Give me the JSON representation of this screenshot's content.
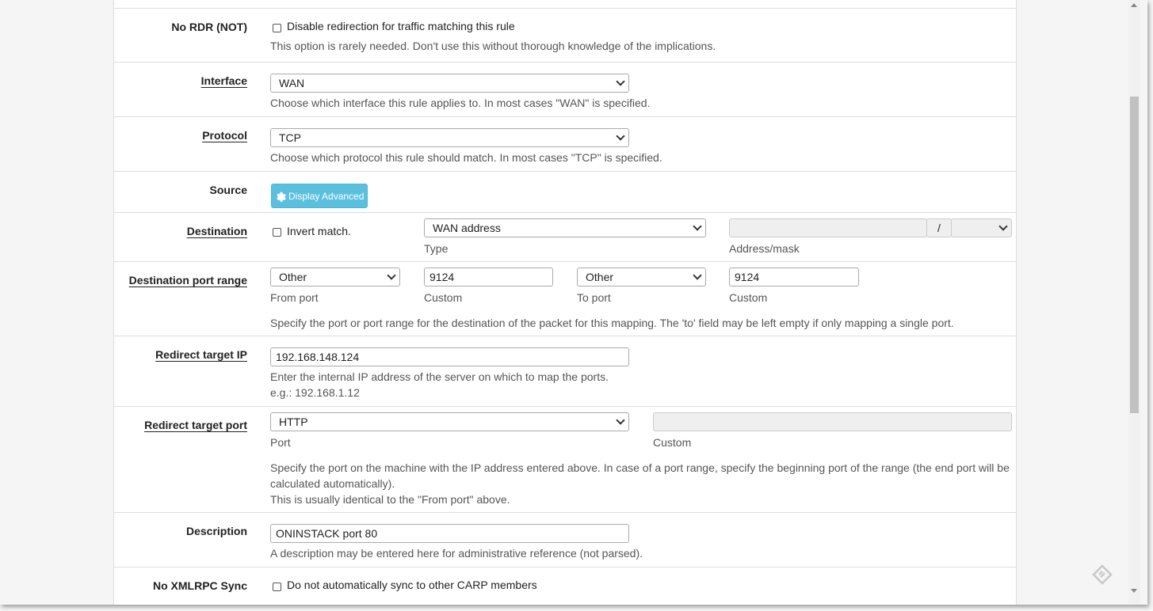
{
  "no_rdr": {
    "label": "No RDR (NOT)",
    "checkbox_label": "Disable redirection for traffic matching this rule",
    "help": "This option is rarely needed. Don't use this without thorough knowledge of the implications."
  },
  "interface": {
    "label": "Interface",
    "value": "WAN",
    "help": "Choose which interface this rule applies to. In most cases \"WAN\" is specified."
  },
  "protocol": {
    "label": "Protocol",
    "value": "TCP",
    "help": "Choose which protocol this rule should match. In most cases \"TCP\" is specified."
  },
  "source": {
    "label": "Source",
    "button": "Display Advanced"
  },
  "destination": {
    "label": "Destination",
    "invert_label": "Invert match.",
    "type_value": "WAN address",
    "type_caption": "Type",
    "address_value": "",
    "slash": "/",
    "mask_value": "",
    "address_caption": "Address/mask"
  },
  "dest_port_range": {
    "label": "Destination port range",
    "from_port_value": "Other",
    "from_port_caption": "From port",
    "from_custom_value": "9124",
    "from_custom_caption": "Custom",
    "to_port_value": "Other",
    "to_port_caption": "To port",
    "to_custom_value": "9124",
    "to_custom_caption": "Custom",
    "help": "Specify the port or port range for the destination of the packet for this mapping. The 'to' field may be left empty if only mapping a single port."
  },
  "redirect_ip": {
    "label": "Redirect target IP",
    "value": "192.168.148.124",
    "help1": "Enter the internal IP address of the server on which to map the ports.",
    "help2": "e.g.: 192.168.1.12"
  },
  "redirect_port": {
    "label": "Redirect target port",
    "port_value": "HTTP",
    "port_caption": "Port",
    "custom_value": "",
    "custom_caption": "Custom",
    "help1": "Specify the port on the machine with the IP address entered above. In case of a port range, specify the beginning port of the range (the end port will be",
    "help2": "calculated automatically).",
    "help3": "This is usually identical to the \"From port\" above."
  },
  "description": {
    "label": "Description",
    "value": "ONINSTACK port 80",
    "help": "A description may be entered here for administrative reference (not parsed)."
  },
  "no_xmlrpc": {
    "label": "No XMLRPC Sync",
    "checkbox_label": "Do not automatically sync to other CARP members"
  },
  "colors": {
    "accent_button": "#5bc0de",
    "panel_bg": "#ffffff",
    "page_bg": "#f5f5f5"
  }
}
